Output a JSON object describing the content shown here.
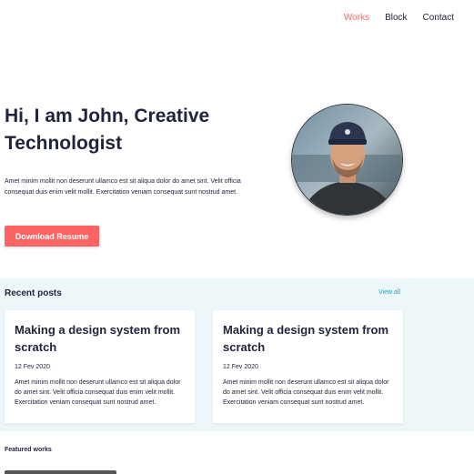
{
  "nav": {
    "items": [
      {
        "label": "Works",
        "active": true
      },
      {
        "label": "Block",
        "active": false
      },
      {
        "label": "Contact",
        "active": false
      }
    ]
  },
  "hero": {
    "title": "Hi, I am John, Creative Technologist",
    "description": "Amet minim mollit non deserunt ullamco est sit aliqua dolor do amet sint. Velit officia consequat duis enim velit mollit. Exercitation veniam consequat sunt nostrud amet.",
    "button_label": "Download Resume"
  },
  "recent_posts": {
    "title": "Recent posts",
    "view_all": "View all",
    "posts": [
      {
        "title": "Making a design system from scratch",
        "date": "12 Fev 2020",
        "excerpt": "Amet minim mollit non deserunt ullamco est sit aliqua dolor do amet sint. Velit officia consequat duis enim velit mollit. Exercitation veniam consequat sunt nostrud amet."
      },
      {
        "title": "Making a design system from scratch",
        "date": "12 Fev 2020",
        "excerpt": "Amet minim mollit non deserunt ullamco est sit aliqua dolor do amet sint. Velit officia consequat duis enim velit mollit. Exercitation veniam consequat sunt nostrud amet."
      }
    ]
  },
  "featured": {
    "title": "Featured works"
  },
  "colors": {
    "accent": "#FF6464",
    "link": "#00A8CC",
    "text": "#21243D",
    "section_bg": "#EDF7FA"
  }
}
